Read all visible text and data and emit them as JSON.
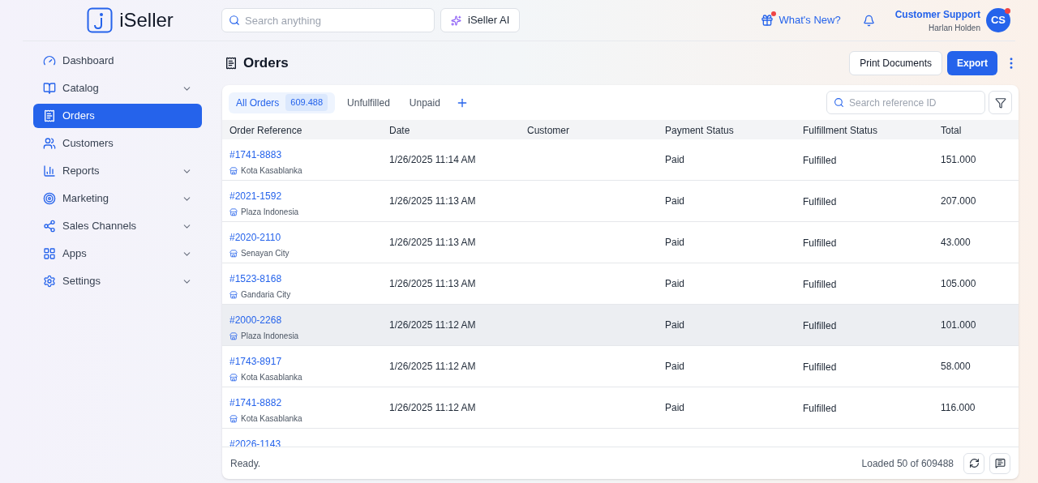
{
  "brand": {
    "name": "iSeller"
  },
  "topbar": {
    "search_placeholder": "Search anything",
    "ai_button": "iSeller AI",
    "whats_new": "What's New?",
    "user": {
      "role": "Customer Support",
      "name": "Harlan Holden",
      "initials": "CS"
    }
  },
  "sidebar": {
    "items": [
      {
        "label": "Dashboard",
        "selected": false,
        "kind": "link"
      },
      {
        "label": "Catalog",
        "selected": false,
        "kind": "group"
      },
      {
        "label": "Orders",
        "selected": true,
        "kind": "link"
      },
      {
        "label": "Customers",
        "selected": false,
        "kind": "link"
      },
      {
        "label": "Reports",
        "selected": false,
        "kind": "group"
      },
      {
        "label": "Marketing",
        "selected": false,
        "kind": "group"
      },
      {
        "label": "Sales Channels",
        "selected": false,
        "kind": "group"
      },
      {
        "label": "Apps",
        "selected": false,
        "kind": "group"
      },
      {
        "label": "Settings",
        "selected": false,
        "kind": "group"
      }
    ]
  },
  "page": {
    "title": "Orders",
    "buttons": [
      {
        "label": "Print Documents",
        "kind": "secondary"
      },
      {
        "label": "Export",
        "kind": "primary"
      }
    ]
  },
  "tabs": [
    {
      "label": "All Orders",
      "count": "609.488",
      "selected": true
    },
    {
      "label": "Unfulfilled",
      "selected": false
    },
    {
      "label": "Unpaid",
      "selected": false
    }
  ],
  "reference_search": {
    "placeholder": "Search reference ID"
  },
  "table": {
    "columns": [
      "Order Reference",
      "Date",
      "Customer",
      "Payment Status",
      "Fulfillment Status",
      "Total"
    ],
    "rows": [
      {
        "reference": "#1741-8883",
        "store": "Kota Kasablanka",
        "date": "1/26/2025 11:14 AM",
        "payment": "Paid",
        "fulfillment": "Fulfilled",
        "total": "151.000",
        "highlighted": false
      },
      {
        "reference": "#2021-1592",
        "store": "Plaza Indonesia",
        "date": "1/26/2025 11:13 AM",
        "payment": "Paid",
        "fulfillment": "Fulfilled",
        "total": "207.000",
        "highlighted": false
      },
      {
        "reference": "#2020-2110",
        "store": "Senayan City",
        "date": "1/26/2025 11:13 AM",
        "payment": "Paid",
        "fulfillment": "Fulfilled",
        "total": "43.000",
        "highlighted": false
      },
      {
        "reference": "#1523-8168",
        "store": "Gandaria City",
        "date": "1/26/2025 11:13 AM",
        "payment": "Paid",
        "fulfillment": "Fulfilled",
        "total": "105.000",
        "highlighted": false
      },
      {
        "reference": "#2000-2268",
        "store": "Plaza Indonesia",
        "date": "1/26/2025 11:12 AM",
        "payment": "Paid",
        "fulfillment": "Fulfilled",
        "total": "101.000",
        "highlighted": true
      },
      {
        "reference": "#1743-8917",
        "store": "Kota Kasablanka",
        "date": "1/26/2025 11:12 AM",
        "payment": "Paid",
        "fulfillment": "Fulfilled",
        "total": "58.000",
        "highlighted": false
      },
      {
        "reference": "#1741-8882",
        "store": "Kota Kasablanka",
        "date": "1/26/2025 11:12 AM",
        "payment": "Paid",
        "fulfillment": "Fulfilled",
        "total": "116.000",
        "highlighted": false
      },
      {
        "reference": "#2026-1143",
        "highlighted": false
      }
    ]
  },
  "status_bar": {
    "status": "Ready.",
    "loaded": "Loaded 50 of 609488"
  }
}
